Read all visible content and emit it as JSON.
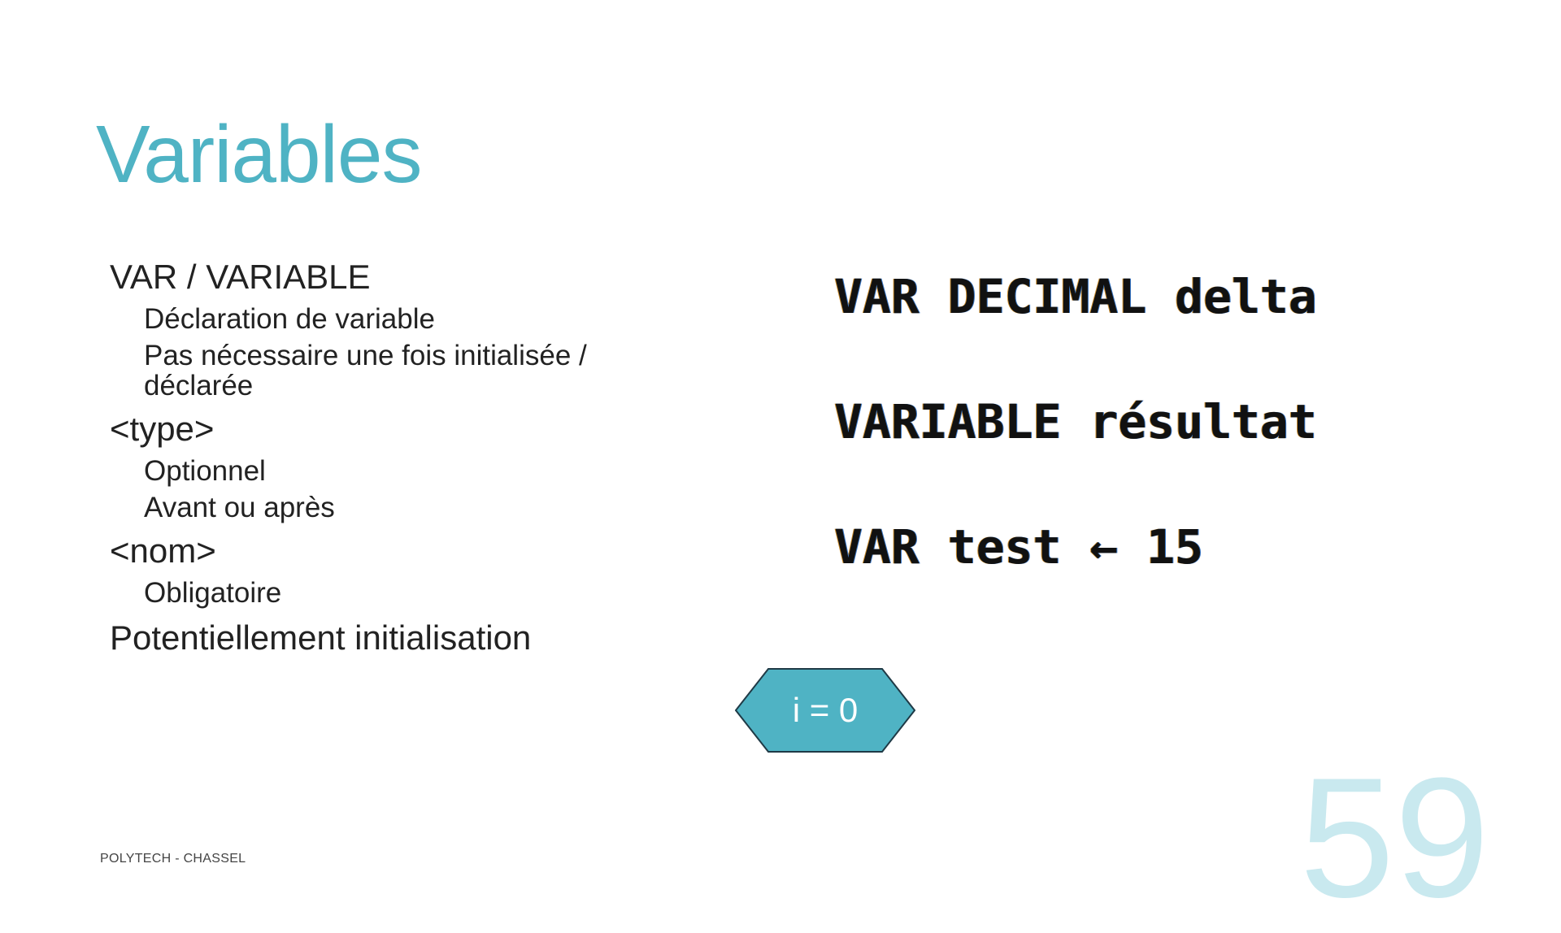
{
  "slide": {
    "title": "Variables",
    "accent_color": "#4fb3c4",
    "footer": "POLYTECH - CHASSEL",
    "page_number": "59"
  },
  "bullets": [
    {
      "label": "VAR / VARIABLE",
      "subitems": [
        "Déclaration de variable",
        "Pas nécessaire une fois initialisée / déclarée"
      ]
    },
    {
      "label": "<type>",
      "subitems": [
        "Optionnel",
        "Avant ou après"
      ]
    },
    {
      "label": "<nom>",
      "subitems": [
        "Obligatoire"
      ]
    },
    {
      "label": "Potentiellement initialisation",
      "subitems": []
    }
  ],
  "code_lines": [
    "VAR DECIMAL delta",
    "VARIABLE résultat",
    "VAR test ← 15"
  ],
  "flowchart_shape": {
    "label": "i = 0",
    "fill_color": "#4fb3c4"
  }
}
